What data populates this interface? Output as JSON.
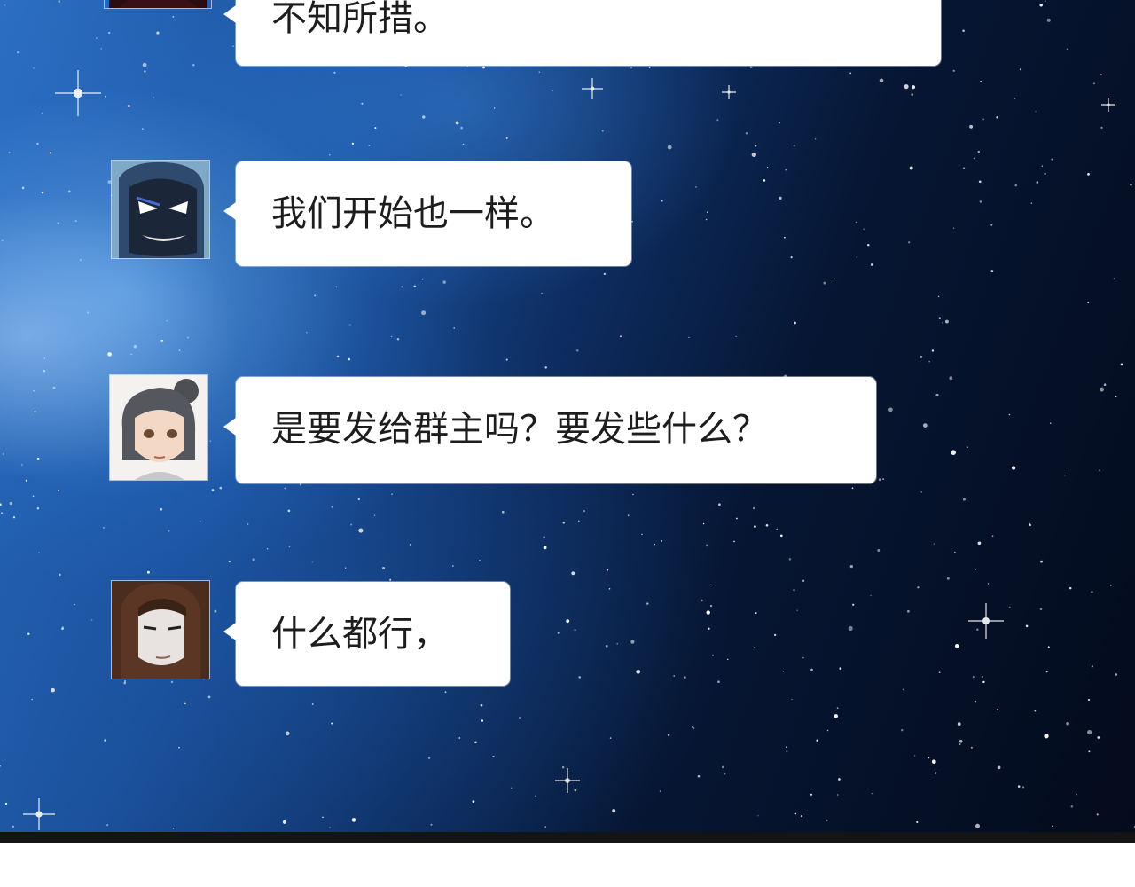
{
  "chat": {
    "messages": [
      {
        "speaker_icon": "avatar-crimson-icon",
        "text": "不知所措。"
      },
      {
        "speaker_icon": "avatar-masked-man-icon",
        "text": "我们开始也一样。"
      },
      {
        "speaker_icon": "avatar-woman-bun-icon",
        "text": "是要发给群主吗？要发些什么？"
      },
      {
        "speaker_icon": "avatar-long-hair-man-icon",
        "text": "什么都行，"
      }
    ]
  },
  "colors": {
    "bubble": "#ffffff",
    "text": "#1d1d1d",
    "space_dark": "#040b1c",
    "space_blue": "#2c6fc2",
    "bottom_bar": "#141414"
  }
}
